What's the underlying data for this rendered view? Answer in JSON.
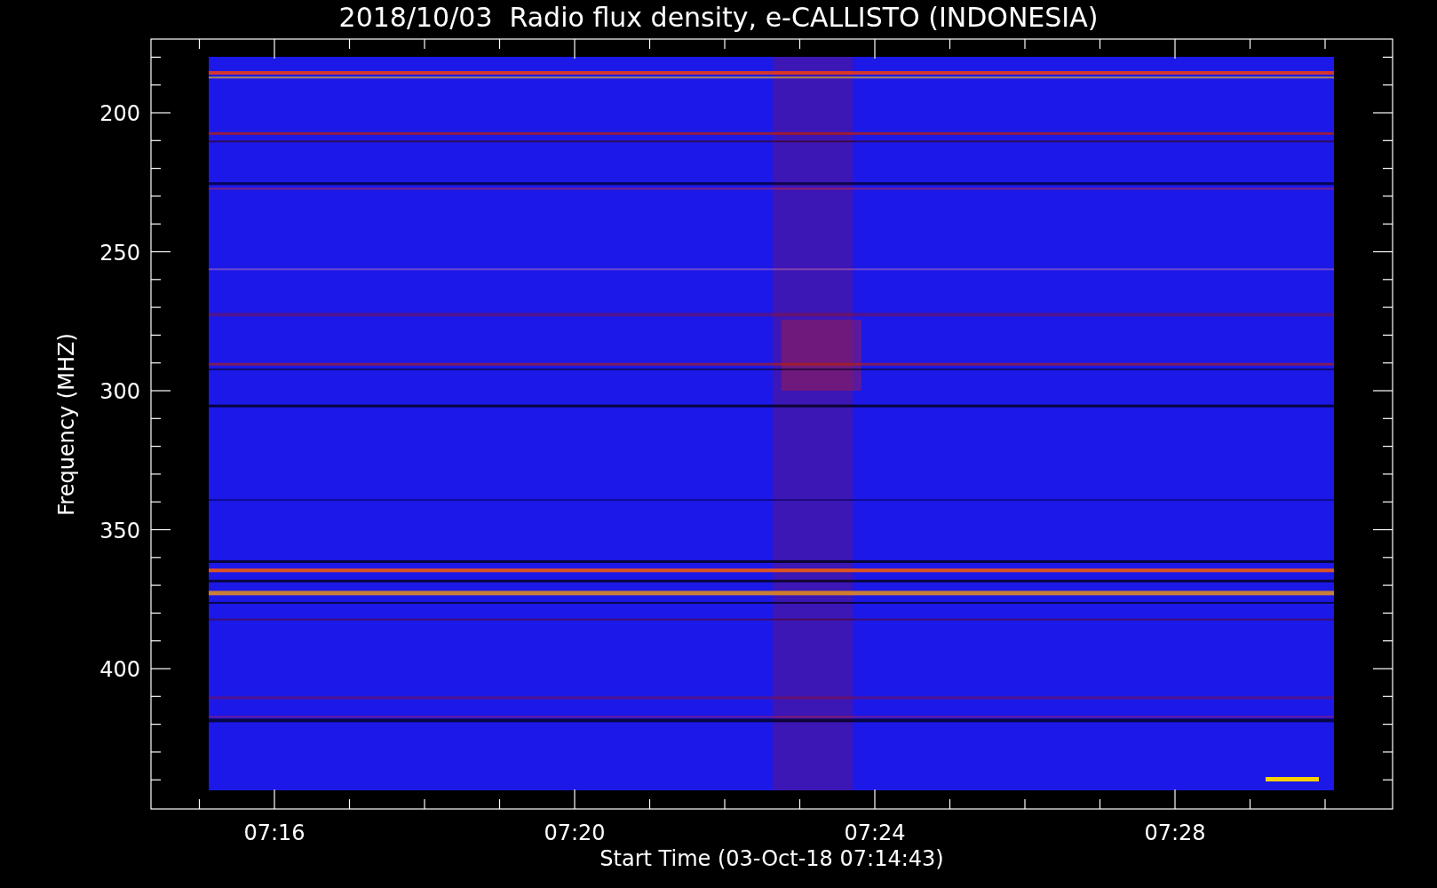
{
  "title": "2018/10/03  Radio flux density, e-CALLISTO (INDONESIA)",
  "y_axis": {
    "label": "Frequency (MHZ)",
    "ticks": [
      "200",
      "250",
      "300",
      "350",
      "400"
    ]
  },
  "x_axis": {
    "label": "Start Time (03-Oct-18 07:14:43)",
    "ticks": [
      "07:16",
      "07:20",
      "07:24",
      "07:28"
    ]
  }
}
